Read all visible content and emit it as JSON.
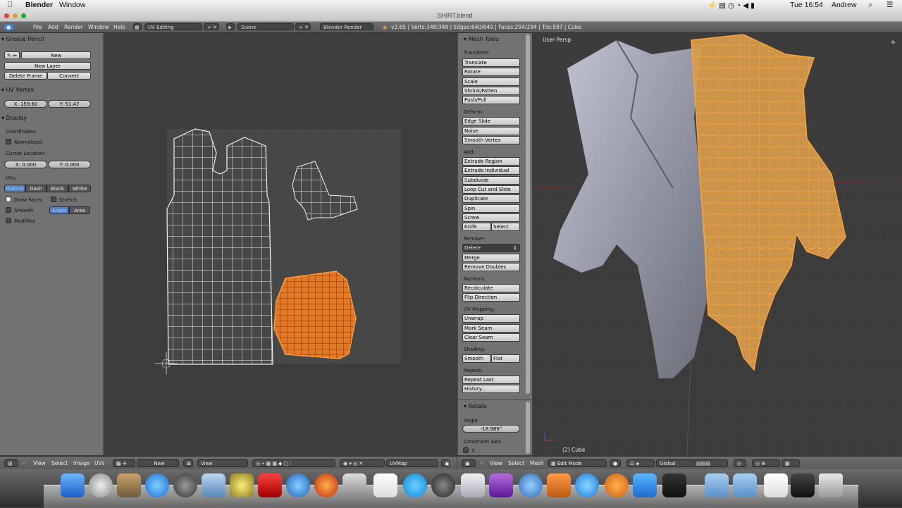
{
  "menubar": {
    "app": "Blender",
    "window": "Window",
    "clock": "Tue 16:54",
    "user": "Andrew"
  },
  "title": "SHIRT.blend",
  "info_header": {
    "menus": [
      "File",
      "Add",
      "Render",
      "Window",
      "Help"
    ],
    "layout": "UV Editing",
    "scene": "Scene",
    "engine": "Blender Render",
    "stats": "v2.65 | Verts:348/348 | Edges:640/640 | Faces:294/294 | Tris:587 | Cube"
  },
  "tool_shelf": {
    "grease_pencil": {
      "title": "Grease Pencil",
      "new": "New",
      "new_layer": "New Layer",
      "delete_frame": "Delete Frame",
      "convert": "Convert"
    },
    "uv_vertex": {
      "title": "UV Vertex",
      "x": "X: 159.60",
      "y": "Y: 51.47"
    },
    "display": {
      "title": "Display",
      "coordinates": "Coordinates:",
      "normalized": "Normalized",
      "cursor_location": "Cursor Location:",
      "cx": "X: 0.000",
      "cy": "Y: 0.000",
      "uvs": "UVs:",
      "uv_styles": [
        "Outline",
        "Dash",
        "Black",
        "White"
      ],
      "draw_faces": "Draw Faces",
      "stretch": "Stretch",
      "smooth": "Smooth",
      "angle": "Angle",
      "area": "Area",
      "modified": "Modified"
    }
  },
  "mesh_tools": {
    "title": "Mesh Tools",
    "transform": "Transform:",
    "transform_items": [
      "Translate",
      "Rotate",
      "Scale",
      "Shrink/Fatten",
      "Push/Pull"
    ],
    "deform": "Deform:",
    "deform_items": [
      "Edge Slide",
      "Noise",
      "Smooth Vertex"
    ],
    "add": "Add:",
    "add_items": [
      "Extrude Region",
      "Extrude Individual",
      "Subdivide",
      "Loop Cut and Slide",
      "Duplicate",
      "Spin",
      "Screw"
    ],
    "knife": "Knife",
    "select": "Select",
    "remove": "Remove:",
    "delete": "Delete",
    "remove_items": [
      "Merge",
      "Remove Doubles"
    ],
    "normals": "Normals:",
    "normals_items": [
      "Recalculate",
      "Flip Direction"
    ],
    "uv_mapping": "UV Mapping:",
    "uv_items": [
      "Unwrap",
      "Mark Seam",
      "Clear Seam"
    ],
    "shading": "Shading:",
    "smooth": "Smooth",
    "flat": "Flat",
    "repeat": "Repeat:",
    "repeat_items": [
      "Repeat Last",
      "History..."
    ],
    "rotate_title": "Rotate",
    "angle_label": "Angle",
    "angle_value": "-18.989°",
    "constraint_axis": "Constraint Axis",
    "axis_x": "X"
  },
  "view3d": {
    "view_label": "User Persp",
    "object_label": "(2) Cube"
  },
  "uv_header": {
    "menus": [
      "View",
      "Select",
      "Image",
      "UVs"
    ],
    "new": "New",
    "view": "View",
    "uvmap": "UVMap"
  },
  "v3d_header": {
    "menus": [
      "View",
      "Select",
      "Mesh"
    ],
    "mode": "Edit Mode",
    "orientation": "Global"
  },
  "colors": {
    "selection": "#f08a2a",
    "panel": "#727272",
    "viewport": "#3d3d3d"
  }
}
